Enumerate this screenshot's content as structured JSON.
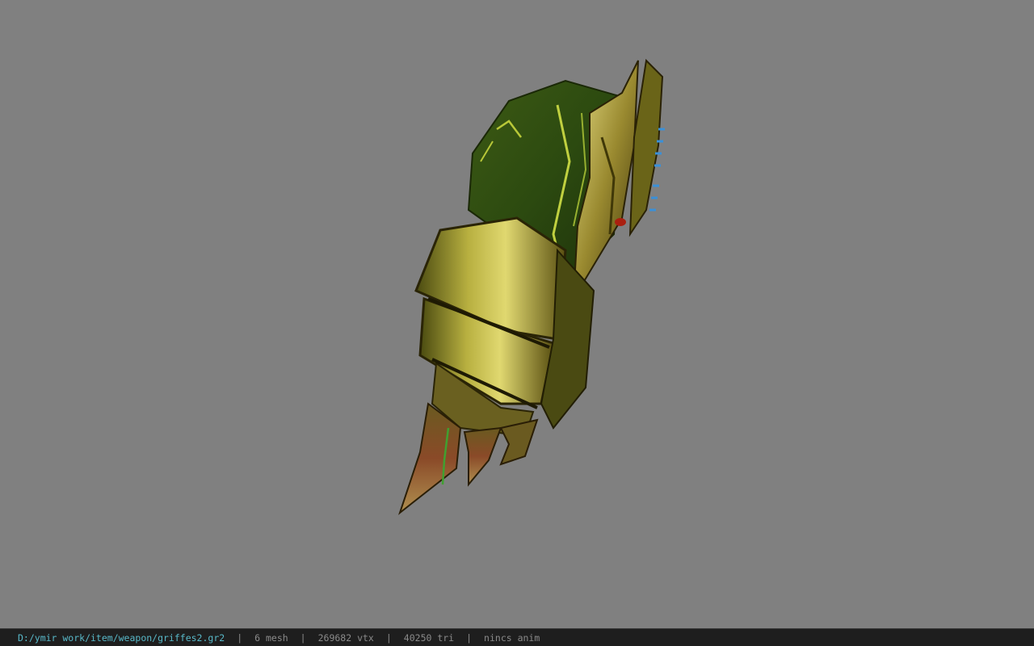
{
  "viewport": {
    "background_color": "#808080",
    "model_name": "griffes2 claw gauntlet model"
  },
  "statusbar": {
    "file_path": "D:/ymir work/item/weapon/griffes2.gr2",
    "mesh_count": "6 mesh",
    "vertex_count": "269682 vtx",
    "triangle_count": "40250 tri",
    "anim_status": "nincs anim",
    "separator": "|",
    "path_color": "#58b8c8"
  }
}
